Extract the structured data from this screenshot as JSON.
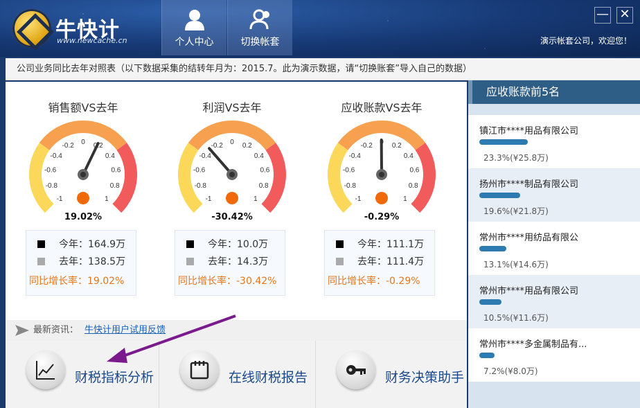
{
  "header": {
    "brand": "牛快计",
    "brand_url": "www.newcache.cn",
    "tabs": [
      {
        "label": "个人中心",
        "icon": "user-icon"
      },
      {
        "label": "切换帐套",
        "icon": "switch-account-icon"
      }
    ],
    "minimize": "—",
    "close": "✕",
    "welcome": "演示帐套公司，欢迎您！"
  },
  "infobar": {
    "text": "公司业务同比去年对照表（以下数据采集的结转年月为：2015.7。此为演示数据，请“切换账套”导入自己的数据）"
  },
  "gauges": [
    {
      "title": "销售额VS去年",
      "value": 0.1902,
      "pct": "19.02%",
      "this_year": "今年：164.9万",
      "last_year": "去年：138.5万",
      "growth": "同比增长率：19.02%"
    },
    {
      "title": "利润VS去年",
      "value": -0.3042,
      "pct": "-30.42%",
      "this_year": "今年：10.0万",
      "last_year": "去年：14.3万",
      "growth": "同比增长率：-30.42%"
    },
    {
      "title": "应收账款VS去年",
      "value": -0.0029,
      "pct": "-0.29%",
      "this_year": "今年：111.1万",
      "last_year": "去年：111.4万",
      "growth": "同比增长率：-0.29%"
    }
  ],
  "gauge_ticks": [
    "-1",
    "-0.8",
    "-0.6",
    "-0.4",
    "-0.2",
    "0",
    "0.2",
    "0.4",
    "0.6",
    "0.8",
    "1"
  ],
  "colors": {
    "gauge_low": "#fbd85a",
    "gauge_mid": "#f7a050",
    "gauge_high": "#f25b5b",
    "accent_orange": "#e8771a",
    "bar_blue": "#2d7bb0"
  },
  "news": {
    "label": "最新资讯：",
    "link": "牛快计用户试用反馈"
  },
  "bottom_buttons": [
    {
      "label": "财税指标分析",
      "icon": "chart-icon"
    },
    {
      "label": "在线财税报告",
      "icon": "calendar-icon"
    },
    {
      "label": "财务决策助手",
      "icon": "key-icon"
    }
  ],
  "receivables": {
    "title": "应收账款前5名",
    "items": [
      {
        "name": "镇江市****用品有限公司",
        "share": 0.233,
        "value": "23.3%(¥25.8万)"
      },
      {
        "name": "扬州市****制品有限公司",
        "share": 0.196,
        "value": "19.6%(¥21.8万)"
      },
      {
        "name": " 常州市****用纺品有限公",
        "share": 0.131,
        "value": "13.1%(¥14.6万)"
      },
      {
        "name": "常州市****用品有限公司",
        "share": 0.105,
        "value": "10.5%(¥11.6万)"
      },
      {
        "name": "常州市****多金属制品有...",
        "share": 0.072,
        "value": "7.2%(¥8.0万)"
      }
    ]
  }
}
